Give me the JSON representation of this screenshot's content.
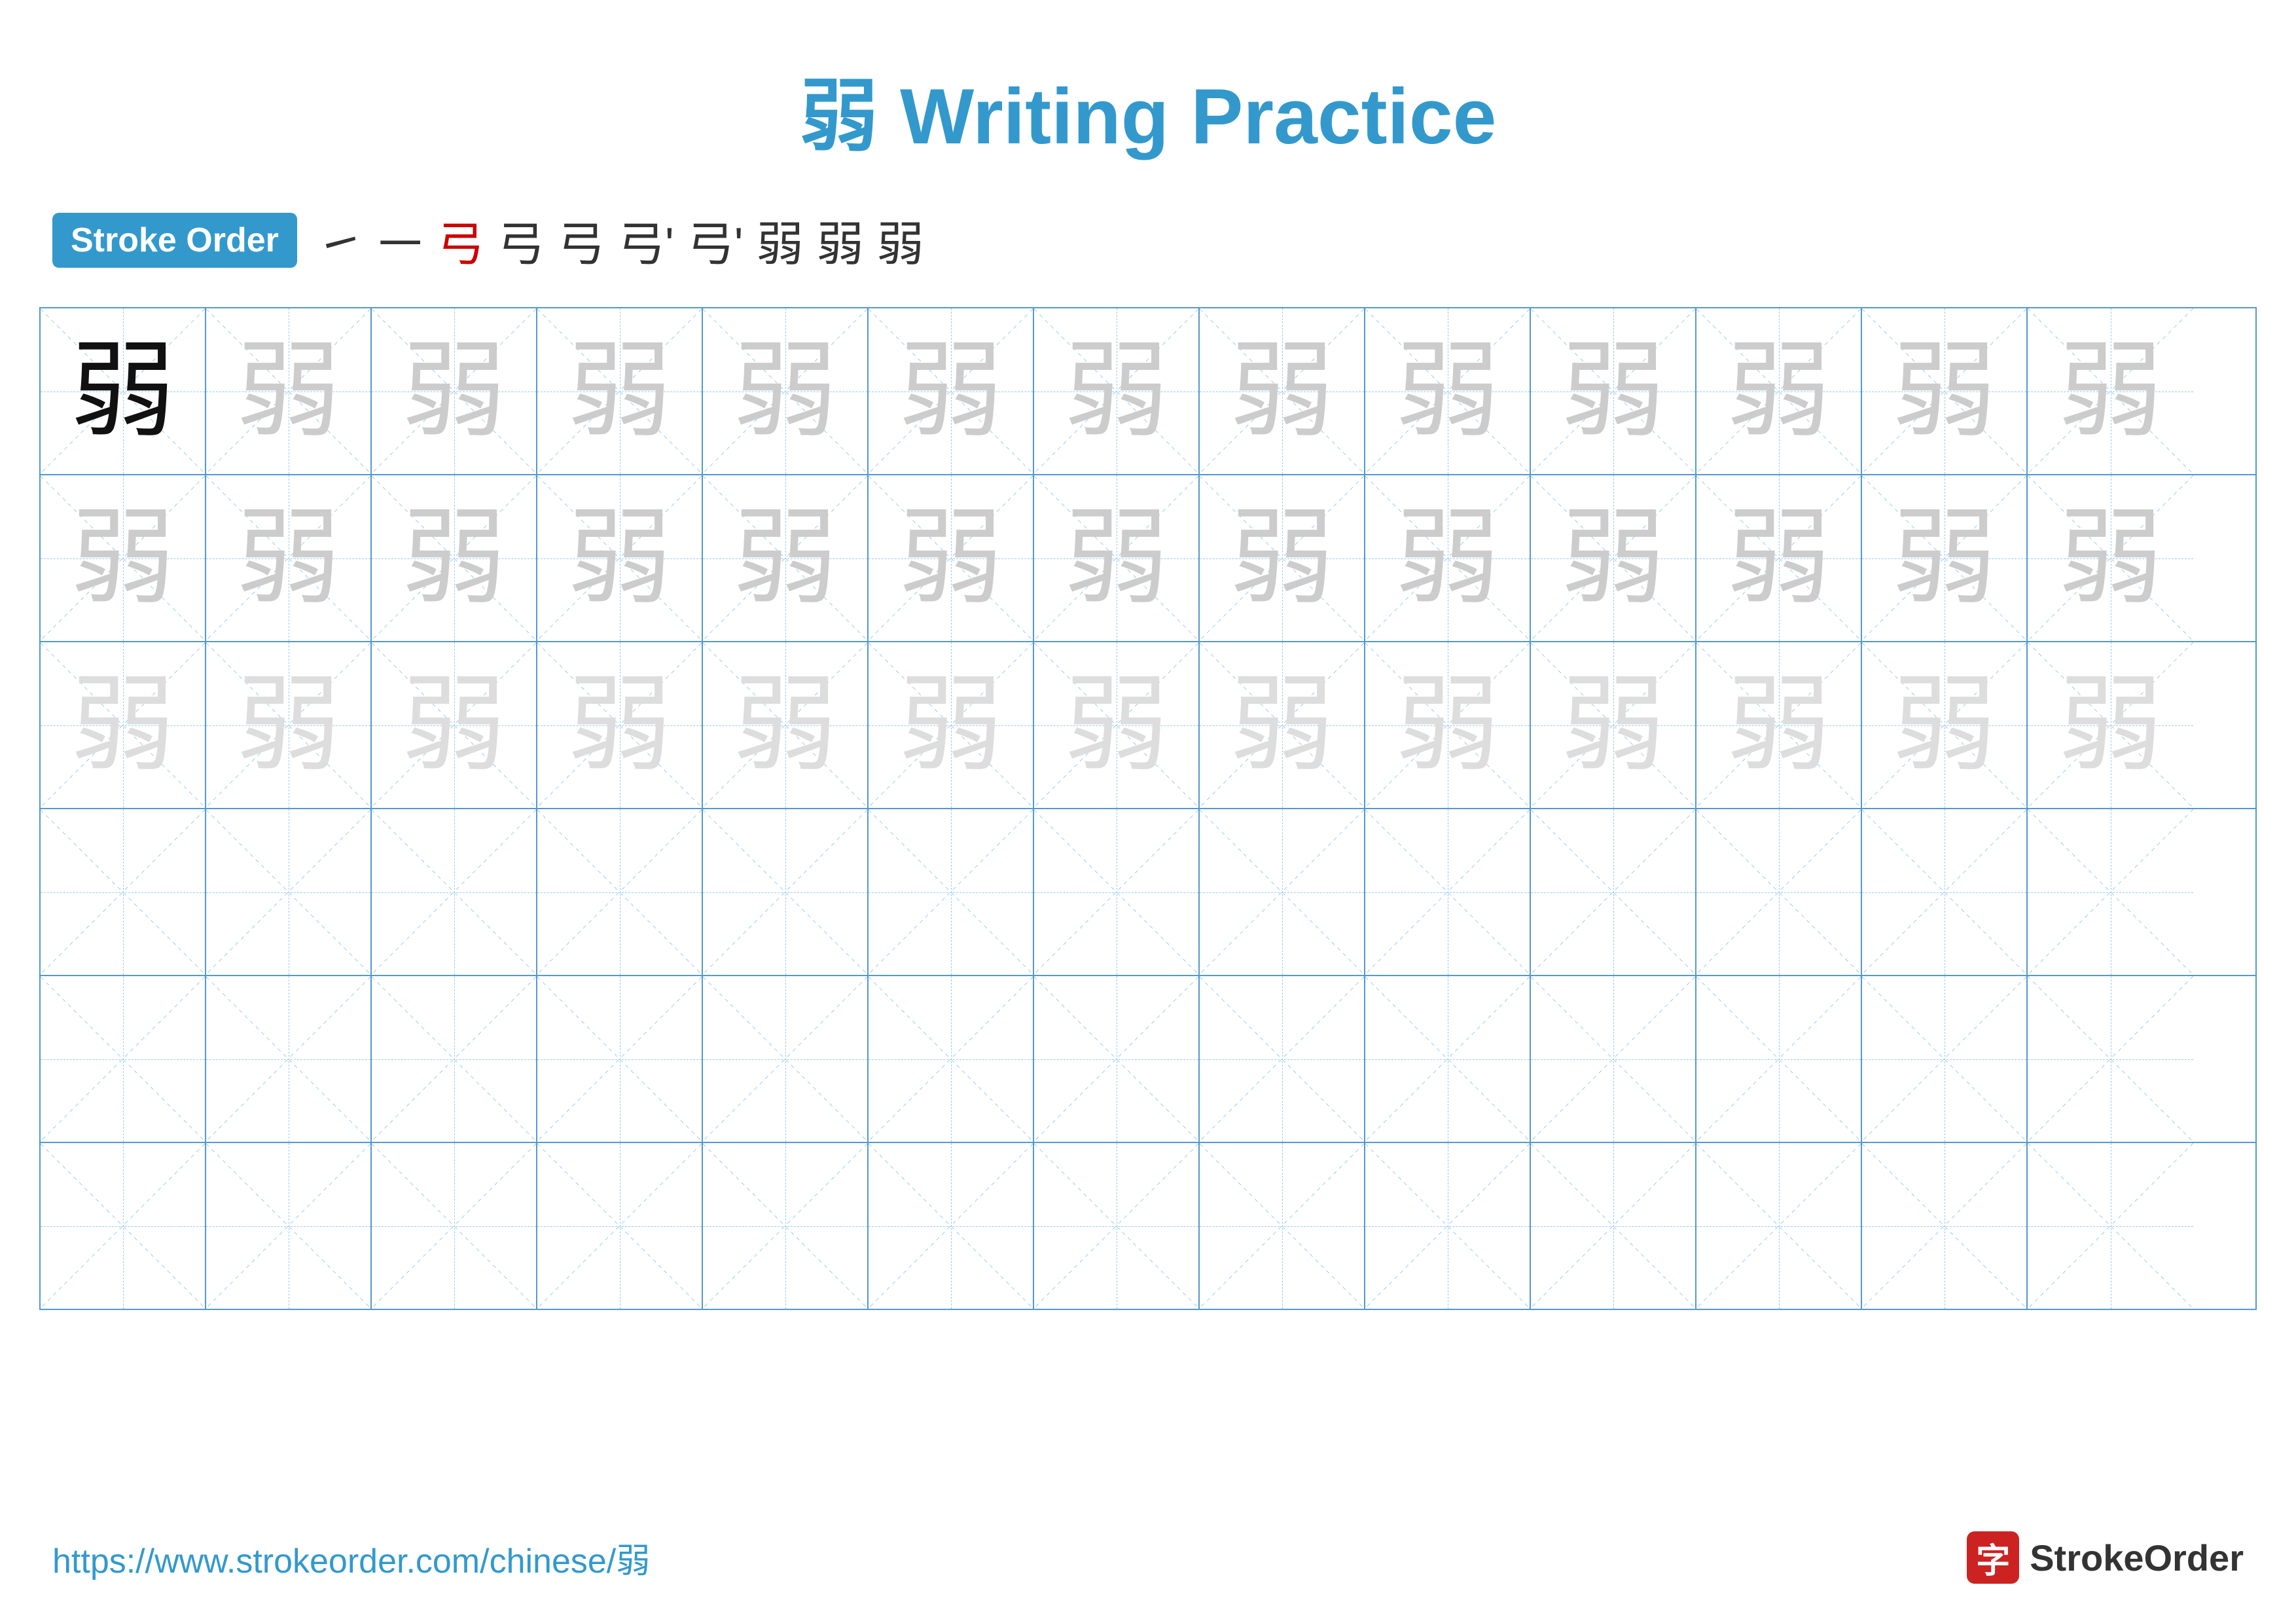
{
  "title": {
    "char": "弱",
    "text": "Writing Practice",
    "full": "弱 Writing Practice"
  },
  "stroke_order": {
    "badge_label": "Stroke Order",
    "strokes": [
      {
        "char": "㇀",
        "red": false
      },
      {
        "char": "㇐",
        "red": false
      },
      {
        "char": "弓",
        "red": true
      },
      {
        "char": "弓",
        "red": false
      },
      {
        "char": "弓",
        "red": false
      },
      {
        "char": "弓'",
        "red": false
      },
      {
        "char": "弓'",
        "red": false
      },
      {
        "char": "弱",
        "red": false
      },
      {
        "char": "弱",
        "red": false
      },
      {
        "char": "弱",
        "red": false
      }
    ]
  },
  "practice_char": "弱",
  "rows": [
    {
      "type": "dark_then_light",
      "count": 13
    },
    {
      "type": "light",
      "count": 13
    },
    {
      "type": "lighter",
      "count": 13
    },
    {
      "type": "empty",
      "count": 13
    },
    {
      "type": "empty",
      "count": 13
    },
    {
      "type": "empty",
      "count": 13
    }
  ],
  "footer": {
    "url": "https://www.strokeorder.com/chinese/弱",
    "logo_char": "字",
    "logo_text": "StrokeOrder"
  }
}
